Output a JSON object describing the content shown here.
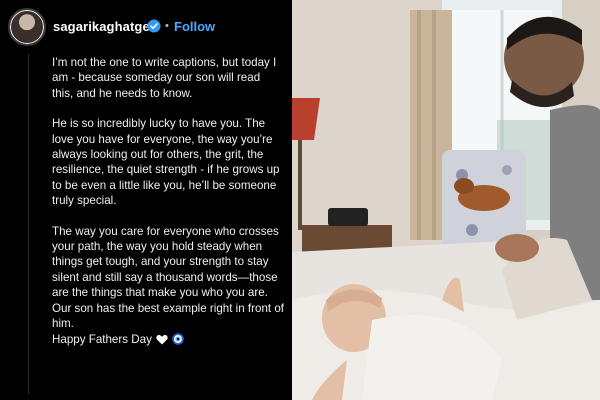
{
  "post": {
    "username": "sagarikaghatge",
    "separator": "•",
    "follow_label": "Follow",
    "caption": {
      "p1": "I’m not the one to write captions, but today I am - because someday our son will read this, and he needs to know.",
      "p2": "He is so incredibly lucky to have you. The love you have for everyone, the way you’re always looking out for others, the grit, the resilience, the quiet strength - if he grows up to be even a little like you, he’ll be someone truly special.",
      "p3a": "The way you care for everyone who crosses your path, the way you hold steady when things get tough, and your strength to stay silent and still say a thousand words—those are the things that make you who you are.",
      "p3b": "Our son has the best example right in front of him.",
      "sign": "Happy Fathers Day"
    },
    "icons": {
      "avatar": "profile-avatar",
      "verified": "verified-badge-icon",
      "heart": "white-heart-emoji",
      "nazar": "nazar-amulet-emoji"
    }
  }
}
